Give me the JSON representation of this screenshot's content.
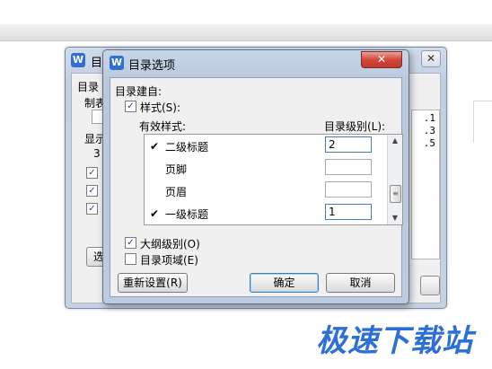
{
  "back_dialog": {
    "title": "目",
    "close_symbol": "✕",
    "labels": [
      "目录",
      "制表",
      "显示",
      "3"
    ],
    "options_button": "选",
    "preview_lines": [
      ".1",
      ".3",
      ".5"
    ]
  },
  "dialog": {
    "title": "目录选项",
    "close_symbol": "✕",
    "build_from_label": "目录建自:",
    "styles_checkbox": {
      "label": "样式(S):",
      "checked": true
    },
    "available_styles_label": "有效样式:",
    "toc_level_label": "目录级别(L):",
    "styles": [
      {
        "name": "二级标题",
        "checked": true,
        "level": "2"
      },
      {
        "name": "页脚",
        "checked": false,
        "level": ""
      },
      {
        "name": "页眉",
        "checked": false,
        "level": ""
      },
      {
        "name": "一级标题",
        "checked": true,
        "level": "1"
      }
    ],
    "outline_checkbox": {
      "label": "大纲级别(O)",
      "checked": true
    },
    "toc_fields_checkbox": {
      "label": "目录项域(E)",
      "checked": false
    },
    "reset_button": "重新设置(R)",
    "ok_button": "确定",
    "cancel_button": "取消"
  },
  "icons": {
    "app": "W",
    "check": "✓",
    "tick": "✔"
  },
  "watermark": "极速下载站",
  "colors": {
    "accent": "#2d6fd6",
    "close_red": "#d2473a"
  }
}
